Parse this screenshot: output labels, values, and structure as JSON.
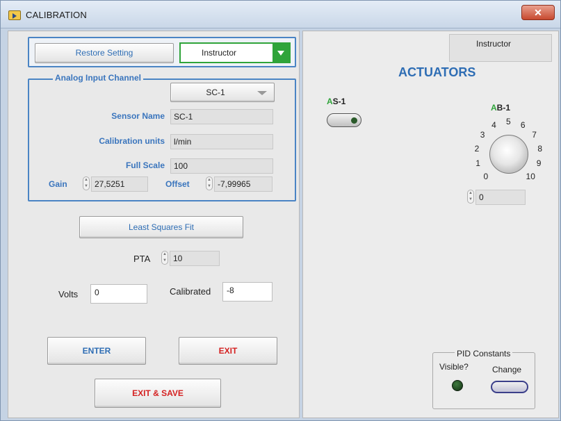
{
  "window": {
    "title": "CALIBRATION",
    "close_glyph": "✕"
  },
  "left": {
    "restore_button": "Restore Setting",
    "role_select": {
      "value": "Instructor"
    },
    "analog_group_title": "Analog Input Channel",
    "channel_select": {
      "value": "SC-1"
    },
    "sensor_name": {
      "label": "Sensor Name",
      "value": "SC-1"
    },
    "calibration_units": {
      "label": "Calibration units",
      "value": "l/min"
    },
    "full_scale": {
      "label": "Full Scale",
      "value": "100"
    },
    "gain": {
      "label": "Gain",
      "value": "27,5251"
    },
    "offset": {
      "label": "Offset",
      "value": "-7,99965"
    },
    "least_squares_button": "Least Squares Fit",
    "pta": {
      "label": "PTA",
      "value": "10"
    },
    "volts": {
      "label": "Volts",
      "value": "0"
    },
    "calibrated": {
      "label": "Calibrated",
      "value": "-8"
    },
    "enter_button": "ENTER",
    "exit_button": "EXIT",
    "exit_save_button": "EXIT & SAVE"
  },
  "right": {
    "tab_label": "Instructor",
    "heading": "ACTUATORS",
    "as1": {
      "label_prefix": "A",
      "label_rest": "S-1",
      "state": "off"
    },
    "ab1": {
      "label_prefix": "A",
      "label_rest": "B-1",
      "dial_ticks": [
        "0",
        "1",
        "2",
        "3",
        "4",
        "5",
        "6",
        "7",
        "8",
        "9",
        "10"
      ],
      "value": "0"
    },
    "pid": {
      "title": "PID Constants",
      "visible_label": "Visible?",
      "change_label": "Change"
    }
  },
  "colors": {
    "accent_blue": "#2e6db4",
    "frame_blue": "#4a84c4",
    "exit_red": "#d42121",
    "select_green": "#2fa43a",
    "led_dark_green": "#1f4a1f"
  }
}
